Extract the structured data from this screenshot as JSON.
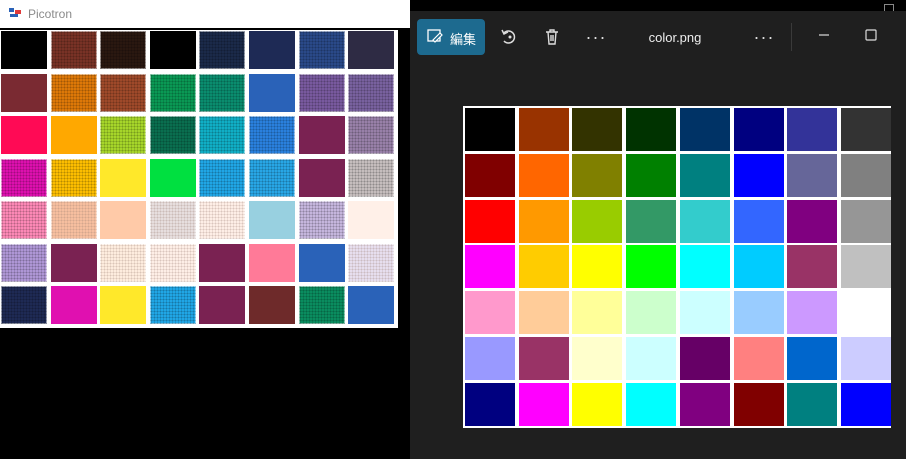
{
  "picotron": {
    "title": "Picotron",
    "palette": [
      {
        "c": "#000000",
        "p": 0
      },
      {
        "c": "#7a3326",
        "p": 1
      },
      {
        "c": "#2a1810",
        "p": 1
      },
      {
        "c": "#000000",
        "p": 0
      },
      {
        "c": "#1b2a4a",
        "p": 1
      },
      {
        "c": "#1e2a55",
        "p": 0
      },
      {
        "c": "#2a4a8a",
        "p": 1
      },
      {
        "c": "#2e2b44",
        "p": 0
      },
      {
        "c": "#7a2a32",
        "p": 0
      },
      {
        "c": "#e07a08",
        "p": 1
      },
      {
        "c": "#a04a2a",
        "p": 1
      },
      {
        "c": "#0a9a55",
        "p": 1
      },
      {
        "c": "#0a8e70",
        "p": 1
      },
      {
        "c": "#2a62b8",
        "p": 0
      },
      {
        "c": "#7a5aa0",
        "p": 1
      },
      {
        "c": "#7a62a0",
        "p": 1
      },
      {
        "c": "#ff0a55",
        "p": 0
      },
      {
        "c": "#ffa800",
        "p": 0
      },
      {
        "c": "#a8d82a",
        "p": 1
      },
      {
        "c": "#0a7050",
        "p": 1
      },
      {
        "c": "#10b0c8",
        "p": 1
      },
      {
        "c": "#2a82e0",
        "p": 1
      },
      {
        "c": "#7a2252",
        "p": 0
      },
      {
        "c": "#9a82aa",
        "p": 1
      },
      {
        "c": "#e010b0",
        "p": 1
      },
      {
        "c": "#ffc000",
        "p": 1
      },
      {
        "c": "#ffe82a",
        "p": 0
      },
      {
        "c": "#00e040",
        "p": 0
      },
      {
        "c": "#20a8e8",
        "p": 1
      },
      {
        "c": "#28a8e8",
        "p": 1
      },
      {
        "c": "#7a2252",
        "p": 0
      },
      {
        "c": "#c8c0c0",
        "p": 1
      },
      {
        "c": "#ff8ab8",
        "p": 1
      },
      {
        "c": "#f8c0a0",
        "p": 1
      },
      {
        "c": "#ffcaa8",
        "p": 0
      },
      {
        "c": "#e8e0e0",
        "p": 1
      },
      {
        "c": "#fff0e8",
        "p": 1
      },
      {
        "c": "#98d0e0",
        "p": 0
      },
      {
        "c": "#c8b8e0",
        "p": 1
      },
      {
        "c": "#fff0e8",
        "p": 0
      },
      {
        "c": "#b098d8",
        "p": 1
      },
      {
        "c": "#7a2252",
        "p": 0
      },
      {
        "c": "#ffeee0",
        "p": 1
      },
      {
        "c": "#fff0e8",
        "p": 1
      },
      {
        "c": "#7a2252",
        "p": 0
      },
      {
        "c": "#ff7a98",
        "p": 0
      },
      {
        "c": "#2a62b8",
        "p": 0
      },
      {
        "c": "#e8e0f0",
        "p": 1
      },
      {
        "c": "#1e2a55",
        "p": 1
      },
      {
        "c": "#e010b0",
        "p": 0
      },
      {
        "c": "#ffe82a",
        "p": 0
      },
      {
        "c": "#20a8e8",
        "p": 1
      },
      {
        "c": "#7a2252",
        "p": 0
      },
      {
        "c": "#6e2a2a",
        "p": 0
      },
      {
        "c": "#0a8e60",
        "p": 1
      },
      {
        "c": "#2a62b8",
        "p": 0
      }
    ]
  },
  "photos": {
    "edit_label": "編集",
    "more_label": "···",
    "filename": "color.png",
    "image_colors": [
      "#000000",
      "#993300",
      "#333300",
      "#003300",
      "#003366",
      "#000080",
      "#333399",
      "#333333",
      "#800000",
      "#ff6600",
      "#808000",
      "#008000",
      "#008080",
      "#0000ff",
      "#666699",
      "#808080",
      "#ff0000",
      "#ff9900",
      "#99cc00",
      "#339966",
      "#33cccc",
      "#3366ff",
      "#800080",
      "#969696",
      "#ff00ff",
      "#ffcc00",
      "#ffff00",
      "#00ff00",
      "#00ffff",
      "#00ccff",
      "#993366",
      "#c0c0c0",
      "#ff99cc",
      "#ffcc99",
      "#ffff99",
      "#ccffcc",
      "#ccffff",
      "#99ccff",
      "#cc99ff",
      "#ffffff",
      "#9999ff",
      "#993366",
      "#ffffcc",
      "#ccffff",
      "#660066",
      "#ff8080",
      "#0066cc",
      "#ccccff",
      "#000080",
      "#ff00ff",
      "#ffff00",
      "#00ffff",
      "#800080",
      "#800000",
      "#008080",
      "#0000ff"
    ]
  }
}
